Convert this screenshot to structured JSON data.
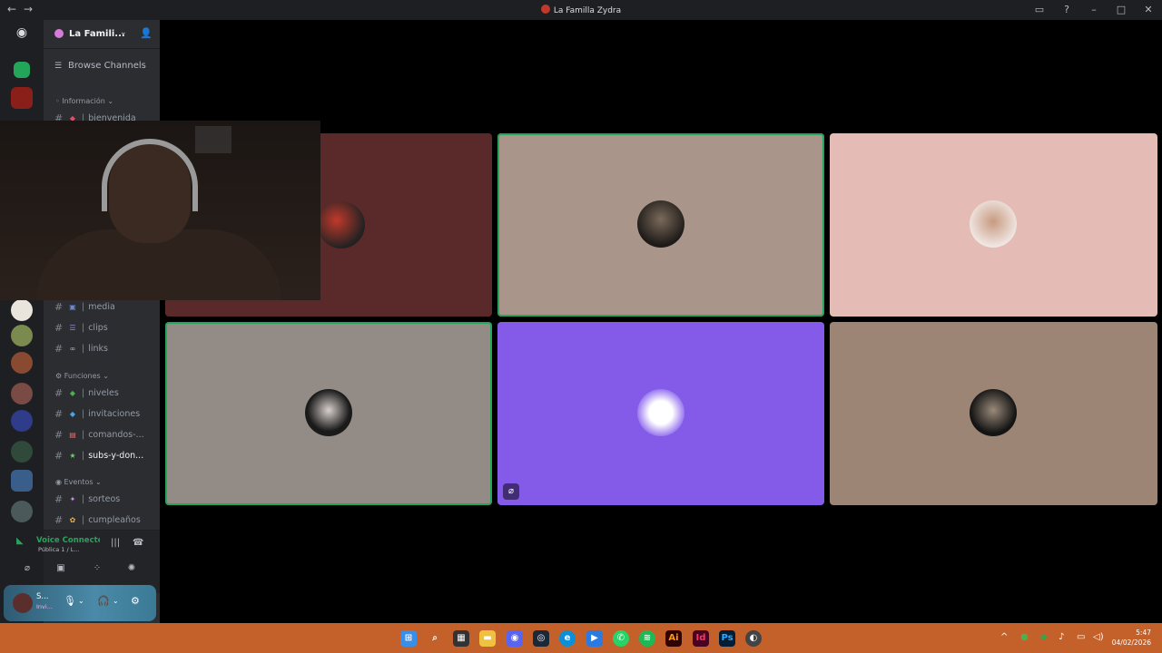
{
  "window": {
    "title": "La Familla Zydra"
  },
  "server": {
    "name": "La Famili..."
  },
  "sidebar": {
    "browse_label": "Browse Channels",
    "categories": {
      "informacion": "Información",
      "funciones": "Funciones",
      "eventos": "Eventos"
    },
    "channels": {
      "bienvenida": "bienvenida",
      "media": "media",
      "clips": "clips",
      "links": "links",
      "niveles": "niveles",
      "invitaciones": "invitaciones",
      "comandos": "comandos-...",
      "subs": "subs-y-don...",
      "sorteos": "sorteos",
      "cumpleanos": "cumpleaños"
    }
  },
  "voice": {
    "status": "Voice Connecte",
    "channel": "Pública 1 / L..."
  },
  "user": {
    "name": "S...",
    "status": "Invi..."
  },
  "colors": {
    "tile_red": "#5a2a2b",
    "tile_taupe": "#a99589",
    "tile_pink": "#e4bcb5",
    "tile_grey": "#928b86",
    "tile_purple": "#845be8",
    "tile_brown": "#9c8574",
    "speaking": "#23a55a",
    "taskbar": "#c4612a"
  },
  "icons": {
    "home": "discord-icon",
    "add_user": "add-user-icon",
    "mute": "mic-off-icon",
    "headset": "headset-icon",
    "settings": "gear-icon"
  },
  "taskbar": {
    "time": "5:47",
    "date": "04/02/2026"
  }
}
